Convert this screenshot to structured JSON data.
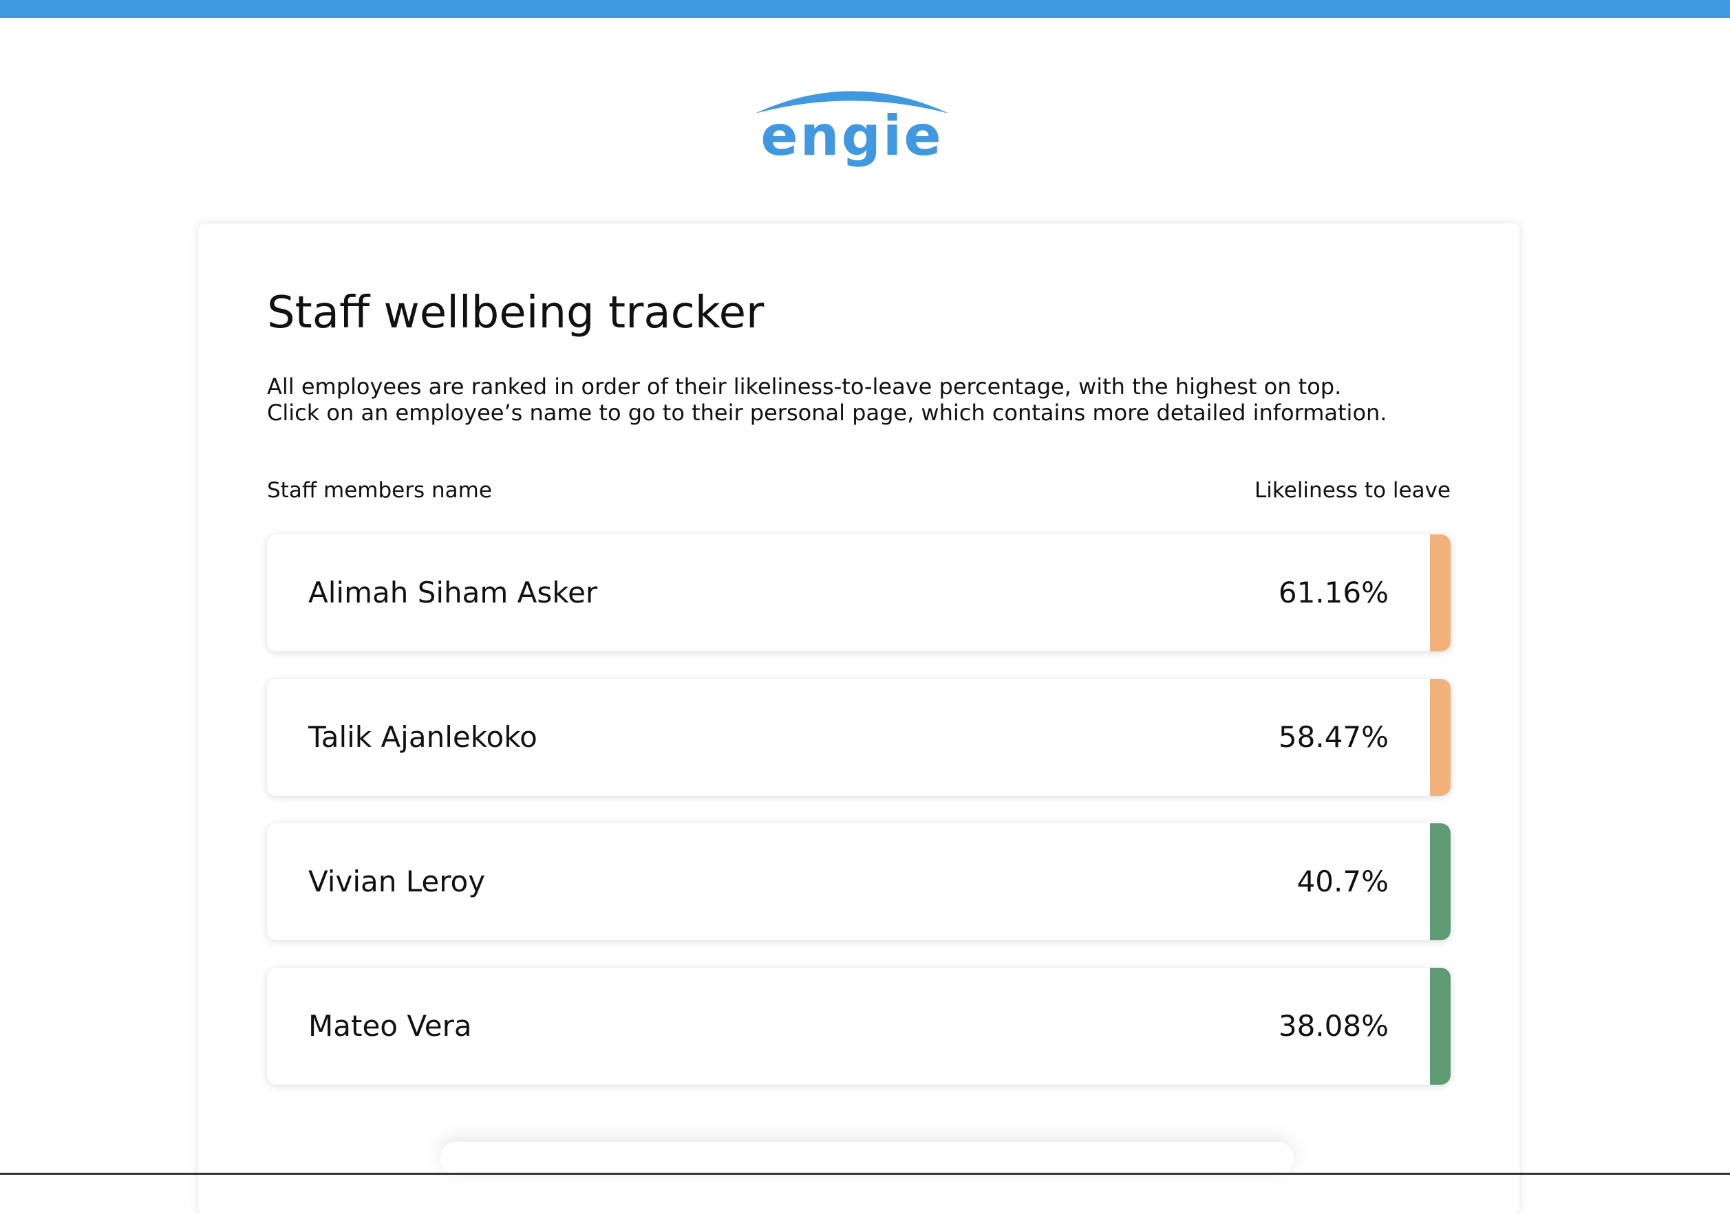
{
  "brand": {
    "logo_text": "engie",
    "accent_color": "#3f98e0"
  },
  "page": {
    "title": "Staff wellbeing tracker",
    "description_line1": "All employees are ranked in order of their likeliness-to-leave percentage, with the highest on top.",
    "description_line2": "Click on an employee’s name to go to their personal page, which contains more detailed information."
  },
  "columns": {
    "name_header": "Staff members name",
    "likeliness_header": "Likeliness to leave"
  },
  "status_colors": {
    "elevated": "#f2b179",
    "low": "#5e9b72"
  },
  "staff": [
    {
      "name": "Alimah Siham Asker",
      "likeliness": "61.16%",
      "status": "elevated"
    },
    {
      "name": "Talik Ajanlekoko",
      "likeliness": "58.47%",
      "status": "elevated"
    },
    {
      "name": "Vivian Leroy",
      "likeliness": "40.7%",
      "status": "low"
    },
    {
      "name": "Mateo Vera",
      "likeliness": "38.08%",
      "status": "low"
    }
  ]
}
